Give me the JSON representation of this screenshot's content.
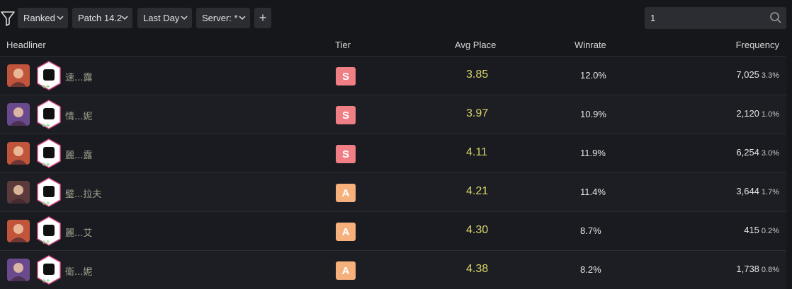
{
  "filters": {
    "queue": "Ranked",
    "patch": "Patch 14.2",
    "time": "Last Day",
    "server": "Server: *",
    "add": "+"
  },
  "search": {
    "value": "1",
    "placeholder": ""
  },
  "table": {
    "headers": {
      "headliner": "Headliner",
      "tier": "Tier",
      "avg_place": "Avg Place",
      "winrate": "Winrate",
      "frequency": "Frequency"
    },
    "rows": [
      {
        "name": "速...露",
        "tier": "S",
        "avg_place": "3.85",
        "winrate": "12.0%",
        "count": "7,025",
        "pct": "3.3%",
        "portrait_color": "#c0553b",
        "trait_icon": "sword-emblem-icon"
      },
      {
        "name": "情...妮",
        "tier": "S",
        "avg_place": "3.97",
        "winrate": "10.9%",
        "count": "2,120",
        "pct": "1.0%",
        "portrait_color": "#6a4a8c",
        "trait_icon": "heart-emblem-icon"
      },
      {
        "name": "麗...露",
        "tier": "S",
        "avg_place": "4.11",
        "winrate": "11.9%",
        "count": "6,254",
        "pct": "3.0%",
        "portrait_color": "#c0553b",
        "trait_icon": "mask-emblem-icon"
      },
      {
        "name": "璧...拉夫",
        "tier": "A",
        "avg_place": "4.21",
        "winrate": "11.4%",
        "count": "3,644",
        "pct": "1.7%",
        "portrait_color": "#5a3a3a",
        "trait_icon": "fist-emblem-icon"
      },
      {
        "name": "麗...艾",
        "tier": "A",
        "avg_place": "4.30",
        "winrate": "8.7%",
        "count": "415",
        "pct": "0.2%",
        "portrait_color": "#c0553b",
        "trait_icon": "mask-emblem-icon"
      },
      {
        "name": "衛...妮",
        "tier": "A",
        "avg_place": "4.38",
        "winrate": "8.2%",
        "count": "1,738",
        "pct": "0.8%",
        "portrait_color": "#6a4a8c",
        "trait_icon": "book-emblem-icon"
      }
    ]
  },
  "colors": {
    "tier_S": "#f07f85",
    "tier_A": "#f5b07c",
    "avg_place": "#d7d46a"
  }
}
